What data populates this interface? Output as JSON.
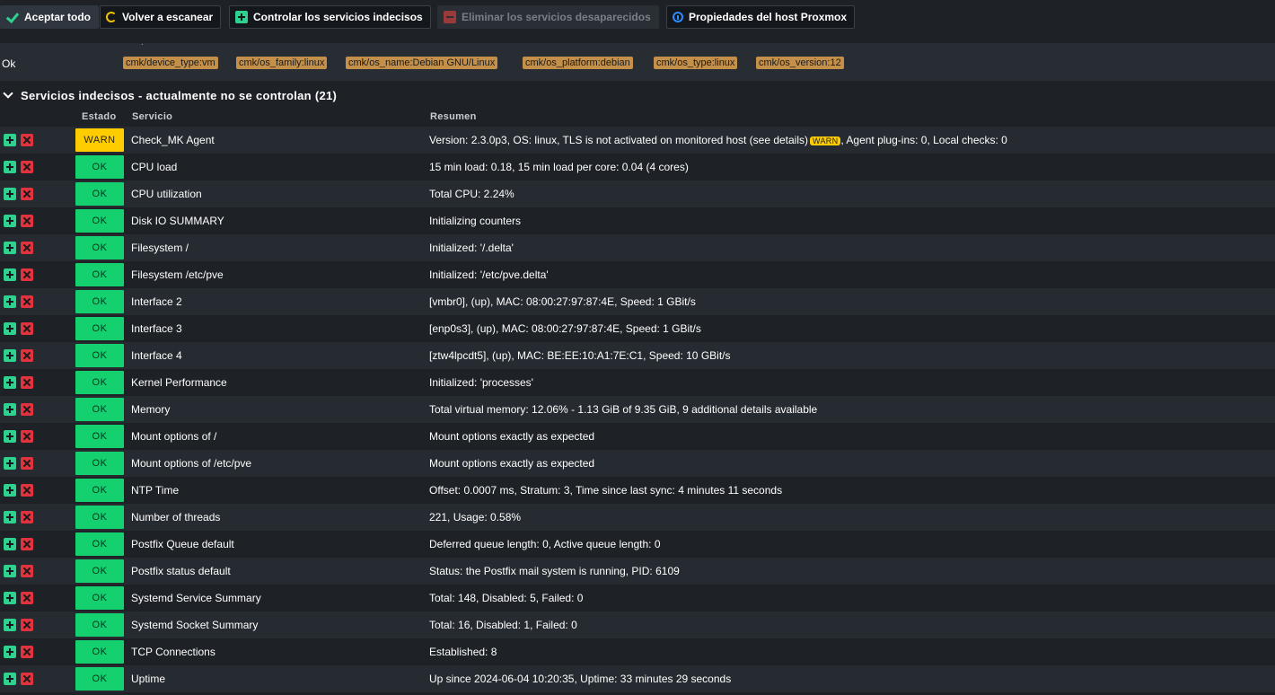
{
  "toolbar": {
    "accept_all": "Aceptar todo",
    "rescan": "Volver a escanear",
    "monitor_undecided": "Controlar los servicios indecisos",
    "remove_vanished": "Eliminar los servicios desaparecidos",
    "host_properties": "Propiedades del host Proxmox"
  },
  "labels_row": {
    "dot": ".",
    "status": "Ok",
    "tags": [
      "cmk/device_type:vm",
      "cmk/os_family:linux",
      "cmk/os_name:Debian GNU/Linux",
      "cmk/os_platform:debian",
      "cmk/os_type:linux",
      "cmk/os_version:12"
    ]
  },
  "section": {
    "title": "Servicios indecisos - actualmente no se controlan (21)"
  },
  "table": {
    "headers": {
      "state": "Estado",
      "service": "Servicio",
      "summary": "Resumen"
    },
    "warn_badge": "WARN",
    "rows": [
      {
        "state": "WARN",
        "service": "Check_MK Agent",
        "summary_pre": "Version: 2.3.0p3, OS: linux, TLS is not activated on monitored host (see details)",
        "summary_post": ", Agent plug-ins: 0, Local checks: 0"
      },
      {
        "state": "OK",
        "service": "CPU load",
        "summary": "15 min load: 0.18, 15 min load per core: 0.04 (4 cores)"
      },
      {
        "state": "OK",
        "service": "CPU utilization",
        "summary": "Total CPU: 2.24%"
      },
      {
        "state": "OK",
        "service": "Disk IO SUMMARY",
        "summary": "Initializing counters"
      },
      {
        "state": "OK",
        "service": "Filesystem /",
        "summary": "Initialized: '/.delta'"
      },
      {
        "state": "OK",
        "service": "Filesystem /etc/pve",
        "summary": "Initialized: '/etc/pve.delta'"
      },
      {
        "state": "OK",
        "service": "Interface 2",
        "summary": "[vmbr0], (up), MAC: 08:00:27:97:87:4E, Speed: 1 GBit/s"
      },
      {
        "state": "OK",
        "service": "Interface 3",
        "summary": "[enp0s3], (up), MAC: 08:00:27:97:87:4E, Speed: 1 GBit/s"
      },
      {
        "state": "OK",
        "service": "Interface 4",
        "summary": "[ztw4lpcdt5], (up), MAC: BE:EE:10:A1:7E:C1, Speed: 10 GBit/s"
      },
      {
        "state": "OK",
        "service": "Kernel Performance",
        "summary": "Initialized: 'processes'"
      },
      {
        "state": "OK",
        "service": "Memory",
        "summary": "Total virtual memory: 12.06% - 1.13 GiB of 9.35 GiB, 9 additional details available"
      },
      {
        "state": "OK",
        "service": "Mount options of /",
        "summary": "Mount options exactly as expected"
      },
      {
        "state": "OK",
        "service": "Mount options of /etc/pve",
        "summary": "Mount options exactly as expected"
      },
      {
        "state": "OK",
        "service": "NTP Time",
        "summary": "Offset: 0.0007 ms, Stratum: 3, Time since last sync: 4 minutes 11 seconds"
      },
      {
        "state": "OK",
        "service": "Number of threads",
        "summary": "221, Usage: 0.58%"
      },
      {
        "state": "OK",
        "service": "Postfix Queue default",
        "summary": "Deferred queue length: 0, Active queue length: 0"
      },
      {
        "state": "OK",
        "service": "Postfix status default",
        "summary": "Status: the Postfix mail system is running, PID: 6109"
      },
      {
        "state": "OK",
        "service": "Systemd Service Summary",
        "summary": "Total: 148, Disabled: 5, Failed: 0"
      },
      {
        "state": "OK",
        "service": "Systemd Socket Summary",
        "summary": "Total: 16, Disabled: 1, Failed: 0"
      },
      {
        "state": "OK",
        "service": "TCP Connections",
        "summary": "Established: 8"
      },
      {
        "state": "OK",
        "service": "Uptime",
        "summary": "Up since 2024-06-04 10:20:35, Uptime: 33 minutes 29 seconds"
      }
    ]
  }
}
